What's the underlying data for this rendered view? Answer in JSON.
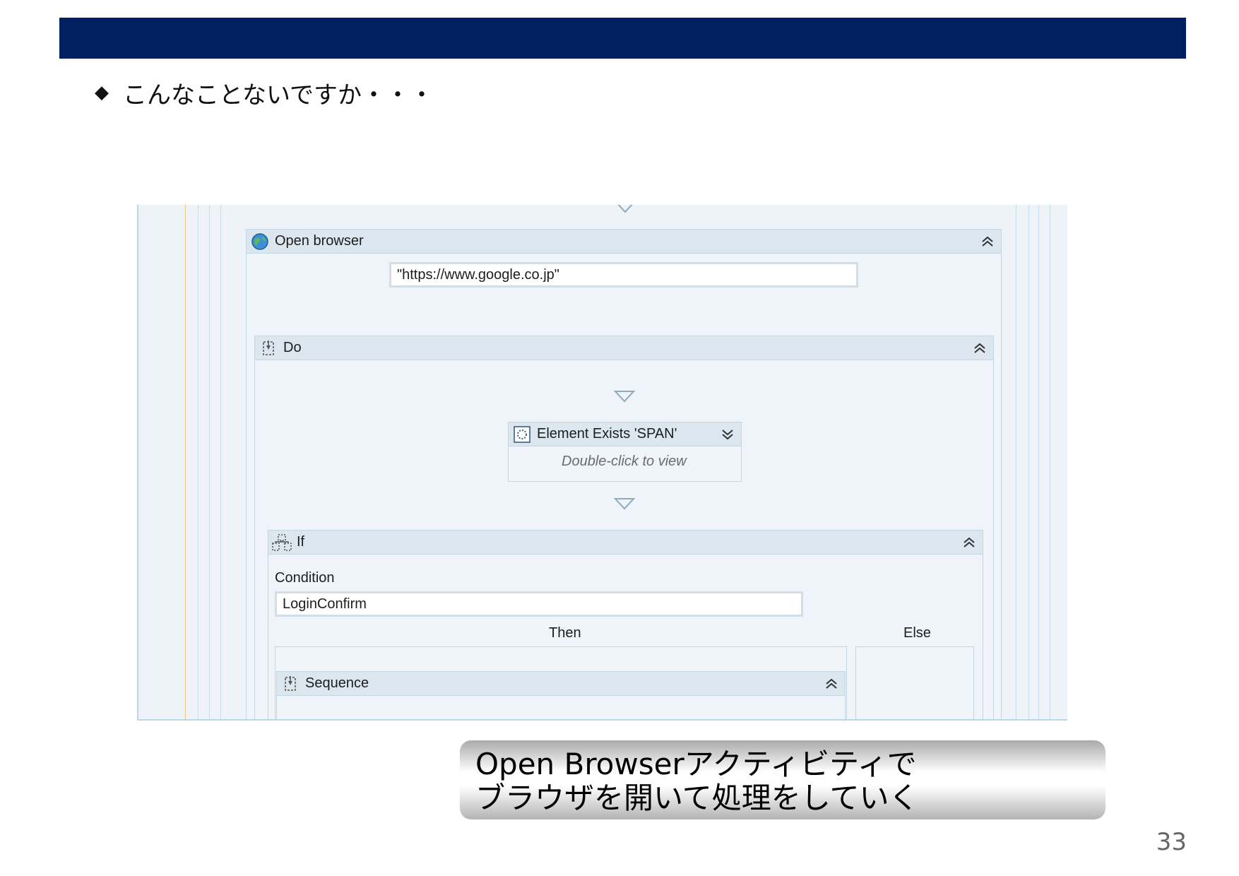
{
  "slide": {
    "bullet_symbol": "◆",
    "bullet_text": "こんなことないですか・・・",
    "page_number": "33"
  },
  "designer": {
    "open_browser": {
      "title": "Open browser",
      "icon": "globe-icon",
      "url_value": "\"https://www.google.co.jp\""
    },
    "do_sequence": {
      "title": "Do",
      "icon": "sequence-icon"
    },
    "element_exists": {
      "title": "Element Exists 'SPAN'",
      "icon": "element-exists-icon",
      "hint": "Double-click to view"
    },
    "if_activity": {
      "title": "If",
      "icon": "if-icon",
      "condition_label": "Condition",
      "condition_value": "LoginConfirm",
      "then_label": "Then",
      "else_label": "Else"
    },
    "sequence": {
      "title": "Sequence",
      "icon": "sequence-icon"
    }
  },
  "callout": {
    "line1": "Open Browserアクティビティで",
    "line2": "ブラウザを開いて処理をしていく"
  },
  "colors": {
    "header_bar": "#00205f",
    "canvas_bg": "#edf3f8",
    "activity_header": "#dce6ee"
  }
}
